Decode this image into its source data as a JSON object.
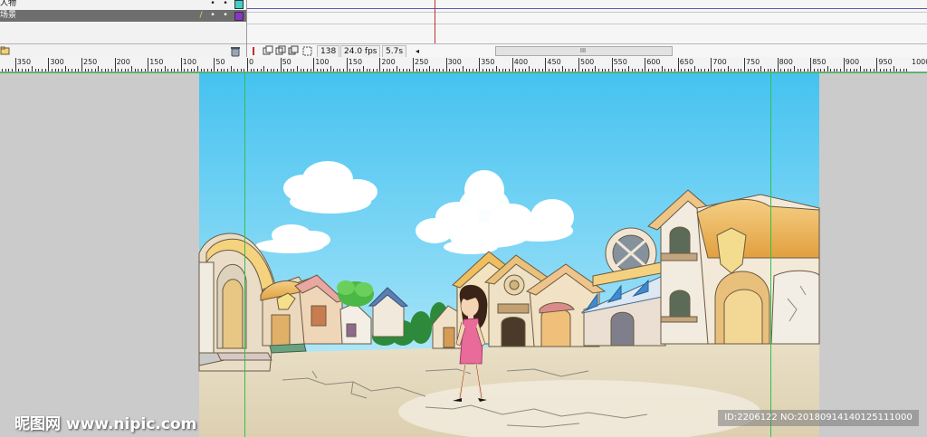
{
  "layers": [
    {
      "name": "人物",
      "color": "#3fd0c9"
    },
    {
      "name": "场景",
      "color": "#8a35c8"
    }
  ],
  "status": {
    "frame": "138",
    "fps": "24.0 fps",
    "time": "5.7s",
    "scroll_grip": "III"
  },
  "ruler": {
    "labels": [
      "350",
      "300",
      "250",
      "200",
      "150",
      "100",
      "50",
      "0",
      "50",
      "100",
      "150",
      "200",
      "250",
      "300",
      "350",
      "400",
      "450",
      "500",
      "550",
      "600",
      "650",
      "700",
      "750",
      "800",
      "850",
      "900",
      "950",
      "1000"
    ]
  },
  "watermark": {
    "left": "昵图网 www.nipic.com",
    "right": "ID:2206122 NO:20180914140125111000"
  },
  "colors": {
    "sky_top": "#45c2f0",
    "sky_bottom": "#d9f4fb",
    "ground": "#e6dcc3",
    "guide": "#2fc24a"
  }
}
